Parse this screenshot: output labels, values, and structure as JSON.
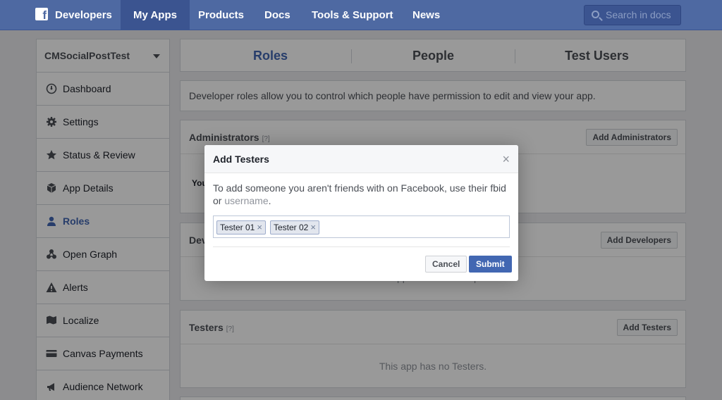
{
  "nav": {
    "brand": "Developers",
    "items": [
      "My Apps",
      "Products",
      "Docs",
      "Tools & Support",
      "News"
    ],
    "search_placeholder": "Search in docs"
  },
  "sidebar": {
    "app_name": "CMSocialPostTest",
    "items": [
      {
        "label": "Dashboard",
        "icon": "dashboard-icon"
      },
      {
        "label": "Settings",
        "icon": "gear-icon"
      },
      {
        "label": "Status & Review",
        "icon": "star-icon"
      },
      {
        "label": "App Details",
        "icon": "cube-icon"
      },
      {
        "label": "Roles",
        "icon": "person-icon"
      },
      {
        "label": "Open Graph",
        "icon": "graph-icon"
      },
      {
        "label": "Alerts",
        "icon": "warning-icon"
      },
      {
        "label": "Localize",
        "icon": "flag-icon"
      },
      {
        "label": "Canvas Payments",
        "icon": "card-icon"
      },
      {
        "label": "Audience Network",
        "icon": "megaphone-icon"
      }
    ],
    "active": "Roles"
  },
  "tabs": [
    "Roles",
    "People",
    "Test Users"
  ],
  "intro": "Developer roles allow you to control which people have permission to edit and view your app.",
  "sections": {
    "administrators": {
      "title": "Administrators",
      "help": "[?]",
      "button": "Add Administrators",
      "partial_text": "You"
    },
    "developers": {
      "title": "Developers",
      "button": "Add Developers",
      "empty": "This app has no Developers."
    },
    "testers": {
      "title": "Testers",
      "help": "[?]",
      "button": "Add Testers",
      "empty": "This app has no Testers."
    }
  },
  "dialog": {
    "title": "Add Testers",
    "close": "×",
    "text_before": "To add someone you aren't friends with on Facebook, use their fbid or ",
    "link": "username",
    "text_after": ".",
    "tokens": [
      "Tester 01",
      "Tester 02"
    ],
    "token_remove": "×",
    "cancel": "Cancel",
    "submit": "Submit"
  },
  "colors": {
    "nav": "#4e69a2",
    "accent": "#4267b2",
    "background": "#e9eaed"
  }
}
